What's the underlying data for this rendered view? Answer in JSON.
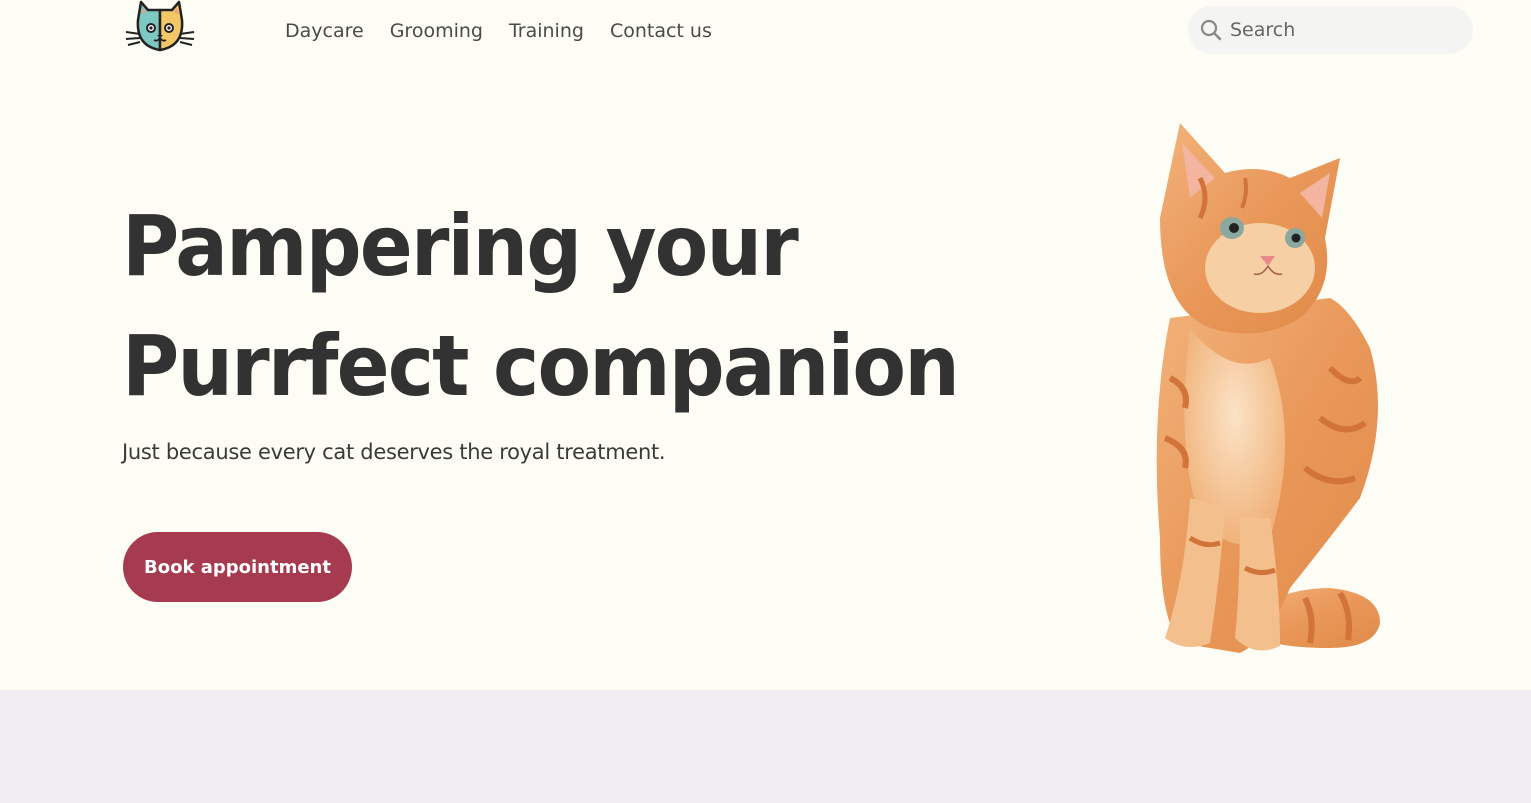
{
  "brand": {
    "logo_icon": "cat-face-icon",
    "colors": {
      "background": "#fdfdf5",
      "accent": "#a63a4f",
      "text": "#333333",
      "footer": "#f0eef0"
    }
  },
  "nav": {
    "items": [
      {
        "label": "Daycare"
      },
      {
        "label": "Grooming"
      },
      {
        "label": "Training"
      },
      {
        "label": "Contact us"
      }
    ]
  },
  "search": {
    "placeholder": "Search",
    "icon": "search-icon"
  },
  "hero": {
    "title_line1": "Pampering your",
    "title_line2": "Purrfect companion",
    "subtitle": "Just because every cat deserves the royal treatment.",
    "cta_label": "Book appointment",
    "image_icon": "orange-kitten-image"
  }
}
